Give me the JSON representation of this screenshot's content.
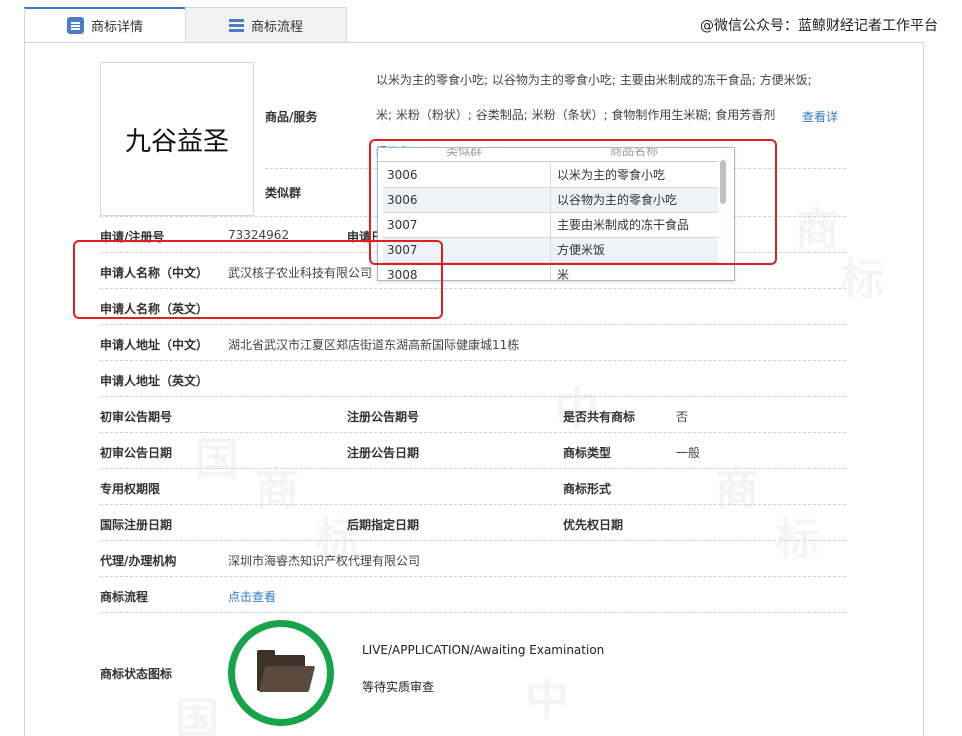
{
  "tabs": [
    {
      "label": "商标详情",
      "icon": "document-icon",
      "active": true
    },
    {
      "label": "商标流程",
      "icon": "list-icon",
      "active": false
    }
  ],
  "watermark_caption": "@微信公众号：蓝鲸财经记者工作平台",
  "background_watermark_chars": [
    "中",
    "国",
    "商",
    "标"
  ],
  "trademark": {
    "logo_text": "九谷益圣",
    "goods_label": "商品/服务",
    "goods_line1": "以米为主的零食小吃; 以谷物为主的零食小吃; 主要由米制成的冻干食品; 方便米饭;",
    "goods_line2": "米; 米粉（粉状）; 谷类制品; 米粉（条状）; 食物制作用生米糊; 食用芳香剂",
    "goods_more_link": "查看详",
    "goods_cut_link": "细信息",
    "similar_group_label": "类似群",
    "popup": {
      "col1": "类似群",
      "col2": "商品名称",
      "rows": [
        {
          "code": "3006",
          "name": "以米为主的零食小吃"
        },
        {
          "code": "3006",
          "name": "以谷物为主的零食小吃"
        },
        {
          "code": "3007",
          "name": "主要由米制成的冻干食品"
        },
        {
          "code": "3007",
          "name": "方便米饭"
        },
        {
          "code": "3008",
          "name": "米"
        }
      ]
    },
    "reg_no_label": "申请/注册号",
    "reg_no": "73324962",
    "apply_date_label": "申请日期",
    "applicant_cn_label": "申请人名称（中文）",
    "applicant_cn": "武汉核子农业科技有限公司",
    "applicant_en_label": "申请人名称（英文）",
    "address_cn_label": "申请人地址（中文）",
    "address_cn": "湖北省武汉市江夏区郑店街道东湖高新国际健康城11栋",
    "address_en_label": "申请人地址（英文）",
    "prelim_issue_label": "初审公告期号",
    "reg_issue_label": "注册公告期号",
    "shared_label": "是否共有商标",
    "shared_value": "否",
    "prelim_date_label": "初审公告日期",
    "reg_date_label": "注册公告日期",
    "type_label": "商标类型",
    "type_value": "一般",
    "exclusive_label": "专用权期限",
    "form_label": "商标形式",
    "intl_date_label": "国际注册日期",
    "later_date_label": "后期指定日期",
    "priority_label": "优先权日期",
    "agent_label": "代理/办理机构",
    "agent_value": "深圳市海睿杰知识产权代理有限公司",
    "process_label": "商标流程",
    "process_link": "点击查看",
    "status_label": "商标状态图标",
    "status_en": "LIVE/APPLICATION/Awaiting Examination",
    "status_cn": "等待实质审查"
  },
  "colors": {
    "accent": "#2b7bc8",
    "highlight": "#e02020",
    "status_ring": "#17a34a"
  }
}
